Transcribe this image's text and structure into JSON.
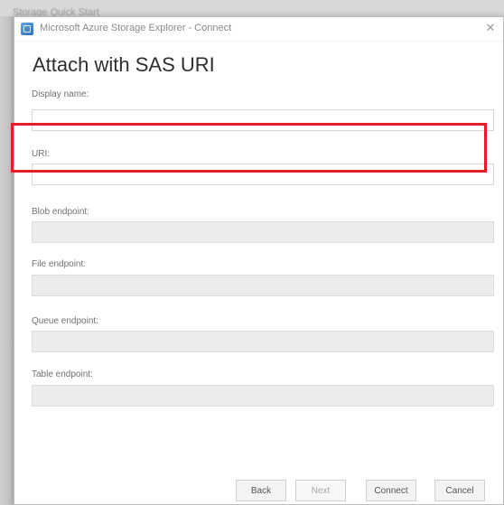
{
  "behind_window": {
    "title": "Storage Quick Start"
  },
  "window": {
    "title": "Microsoft Azure Storage Explorer - Connect",
    "close_glyph": "✕",
    "heading": "Attach with SAS URI"
  },
  "form": {
    "display_name": {
      "label": "Display name:",
      "value": ""
    },
    "uri": {
      "label": "URI:",
      "value": ""
    },
    "blob_endpoint": {
      "label": "Blob endpoint:",
      "value": ""
    },
    "file_endpoint": {
      "label": "File endpoint:",
      "value": ""
    },
    "queue_endpoint": {
      "label": "Queue endpoint:",
      "value": ""
    },
    "table_endpoint": {
      "label": "Table endpoint:",
      "value": ""
    }
  },
  "buttons": {
    "back": "Back",
    "next": "Next",
    "connect": "Connect",
    "cancel": "Cancel"
  },
  "colors": {
    "highlight": "#e31e26"
  },
  "icons": {
    "app": "azure-storage-explorer-icon",
    "close": "close-icon"
  }
}
